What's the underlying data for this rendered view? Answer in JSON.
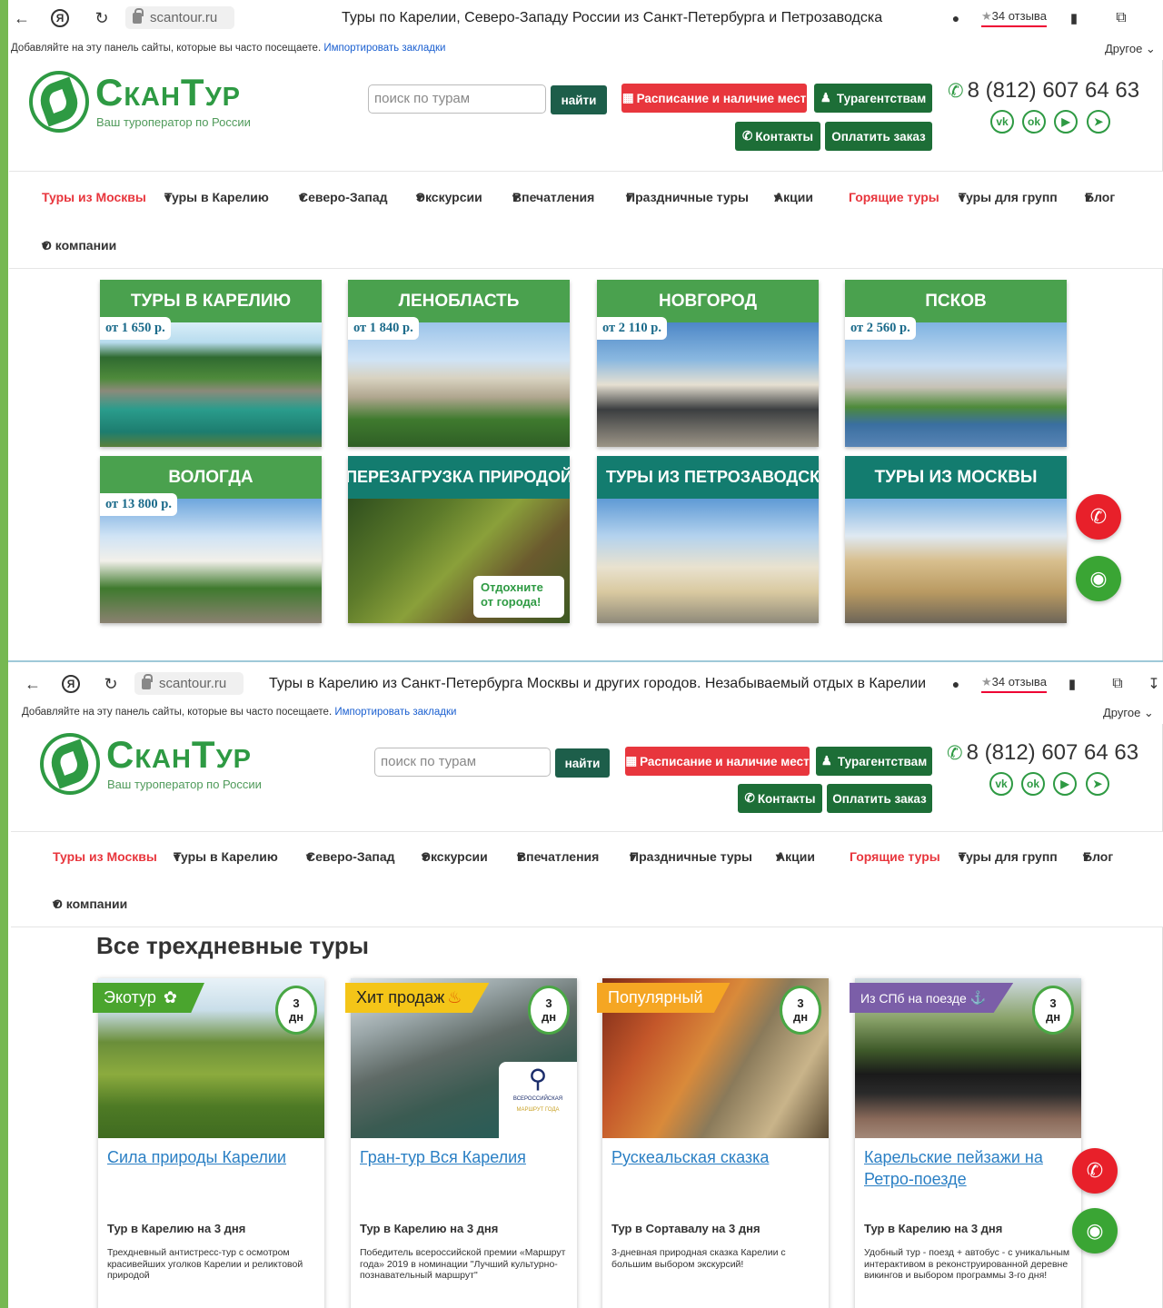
{
  "screens": [
    {
      "url": "scantour.ru",
      "page_title": "Туры по Карелии, Северо-Западу России из Санкт-Петербурга и Петрозаводска",
      "reviews": "34 отзыва"
    },
    {
      "url": "scantour.ru",
      "page_title": "Туры в Карелию из Санкт-Петербурга Москвы и других городов. Незабываемый отдых в Карелии",
      "reviews": "34 отзыва"
    }
  ],
  "bookmarks": {
    "prompt": "Добавляйте на эту панель сайты, которые вы часто посещаете.",
    "import": "Импортировать закладки",
    "other": "Другое"
  },
  "site": {
    "logo_name": "СканТур",
    "logo_tagline": "Ваш туроператор по России",
    "search_placeholder": "поиск по турам",
    "search_button": "найти",
    "schedule_button": "Расписание и наличие мест",
    "agents_button": "Турагентствам",
    "contacts_button": "Контакты",
    "pay_button": "Оплатить заказ",
    "phone": "8 (812) 607 64 63",
    "social": [
      "vk-icon",
      "odnoklassniki-icon",
      "youtube-icon",
      "telegram-icon"
    ],
    "nav": [
      "Туры из Москвы",
      "Туры в Карелию",
      "Северо-Запад",
      "Экскурсии",
      "Впечатления",
      "Праздничные туры",
      "Акции",
      "Горящие туры",
      "Туры для групп",
      "Блог",
      "О компании"
    ]
  },
  "tiles": [
    {
      "title": "ТУРЫ В КАРЕЛИЮ",
      "price": "от 1 650 р."
    },
    {
      "title": "ЛЕНОБЛАСТЬ",
      "price": "от 1 840 р."
    },
    {
      "title": "НОВГОРОД",
      "price": "от 2 110 р."
    },
    {
      "title": "ПСКОВ",
      "price": "от 2 560 р."
    },
    {
      "title": "ВОЛОГДА",
      "price": "от 13 800 р."
    },
    {
      "title": "ПЕРЕЗАГРУЗКА ПРИРОДОЙ",
      "price": ""
    },
    {
      "title": "ТУРЫ ИЗ ПЕТРОЗАВОДСКА",
      "price": ""
    },
    {
      "title": "ТУРЫ ИЗ МОСКВЫ",
      "price": ""
    }
  ],
  "tile_overlay": "Отдохните от города!",
  "section_title": "Все трехдневные туры",
  "cards": [
    {
      "badge": "Экотур",
      "days": "3 дн",
      "title": "Сила природы Карелии",
      "subtitle": "Тур в Карелию на 3 дня",
      "desc": "Трехдневный антистресс-тур с осмотром красивейших уголков Карелии и реликтовой природой"
    },
    {
      "badge": "Хит продаж",
      "days": "3 дн",
      "title": "Гран-тур Вся Карелия",
      "subtitle": "Тур в Карелию на 3 дня",
      "desc": "Победитель всероссийской премии «Маршрут года» 2019 в номинации \"Лучший культурно-познавательный маршрут\""
    },
    {
      "badge": "Популярный",
      "days": "3 дн",
      "title": "Рускеальская сказка",
      "subtitle": "Тур в Сортавалу на 3 дня",
      "desc": "3-дневная природная сказка Карелии с большим выбором экскурсий!"
    },
    {
      "badge": "Из СПб на поезде",
      "days": "3 дн",
      "title": "Карельские пейзажи на Ретро-поезде",
      "subtitle": "Тур в Карелию на 3 дня",
      "desc": "Удобный тур - поезд + автобус - с уникальным интерактивом в реконструированной деревне викингов и выбором программы 3-го дня!"
    }
  ],
  "award_logo": {
    "line1": "ВСЕРОССИЙСКАЯ",
    "line2": "МАРШРУТ ГОДА"
  }
}
